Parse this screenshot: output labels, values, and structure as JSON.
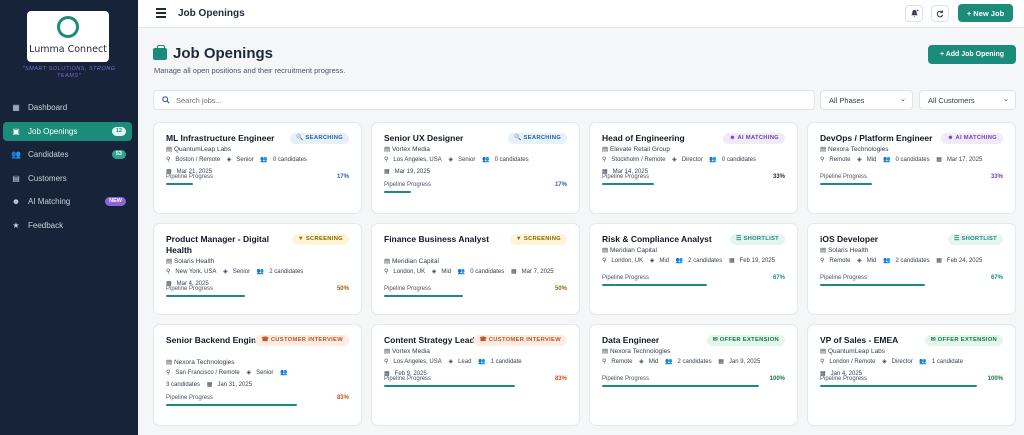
{
  "app": {
    "name": "Lumma Connect",
    "tagline": "\"SMART SOLUTIONS, STRONG TEAMS\""
  },
  "nav": [
    {
      "label": "Dashboard",
      "icon": "dashboard-icon",
      "badge": ""
    },
    {
      "label": "Job Openings",
      "icon": "briefcase-icon",
      "badge": "12",
      "active": true
    },
    {
      "label": "Candidates",
      "icon": "users-icon",
      "badge": "53"
    },
    {
      "label": "Customers",
      "icon": "building-icon",
      "badge": ""
    },
    {
      "label": "AI Matching",
      "icon": "robot-icon",
      "badge": "NEW"
    },
    {
      "label": "Feedback",
      "icon": "star-icon",
      "badge": ""
    }
  ],
  "topbar": {
    "title": "Job Openings",
    "new_job": "+ New Job"
  },
  "header": {
    "title": "Job Openings",
    "subtitle": "Manage all open positions and their recruitment progress.",
    "add_button": "+ Add Job Opening"
  },
  "filters": {
    "search_placeholder": "Search jobs...",
    "phase": "All Phases",
    "customer": "All Customers"
  },
  "pipeline_label": "Pipeline Progress",
  "colors": {
    "accent": "#1b8c7a",
    "sidebar": "#172338"
  },
  "jobs": [
    {
      "title": "ML Infrastructure Engineer",
      "company": "QuantumLeap Labs",
      "status": "SEARCHING",
      "status_type": "searching",
      "location": "Boston / Remote",
      "level": "Senior",
      "candidates": "0 candidates",
      "date": "Mar 21, 2025",
      "progress": 17,
      "progress_color": "#2563a8"
    },
    {
      "title": "Senior UX Designer",
      "company": "Vortex Media",
      "status": "SEARCHING",
      "status_type": "searching",
      "location": "Los Angeles, USA",
      "level": "Senior",
      "candidates": "0 candidates",
      "date": "Mar 19, 2025",
      "progress": 17,
      "progress_color": "#2563a8"
    },
    {
      "title": "Head of Engineering",
      "company": "Elevate Retail Group",
      "status": "AI MATCHING",
      "status_type": "ai",
      "location": "Stockholm / Remote",
      "level": "Director",
      "candidates": "0 candidates",
      "date": "Mar 14, 2025",
      "progress": 33,
      "progress_color": "#1f2a37"
    },
    {
      "title": "DevOps / Platform Engineer",
      "company": "Nexora Technologies",
      "status": "AI MATCHING",
      "status_type": "ai",
      "location": "Remote",
      "level": "Mid",
      "candidates": "0 candidates",
      "date": "Mar 17, 2025",
      "progress": 33,
      "progress_color": "#7042b8"
    },
    {
      "title": "Product Manager - Digital Health",
      "company": "Solaris Health",
      "status": "SCREENING",
      "status_type": "screening",
      "location": "New York, USA",
      "level": "Senior",
      "candidates": "2 candidates",
      "date": "Mar 4, 2025",
      "progress": 50,
      "progress_color": "#a16207"
    },
    {
      "title": "Finance Business Analyst",
      "company": "Meridian Capital",
      "status": "SCREENING",
      "status_type": "screening",
      "location": "London, UK",
      "level": "Mid",
      "candidates": "0 candidates",
      "date": "Mar 7, 2025",
      "progress": 50,
      "progress_color": "#a16207"
    },
    {
      "title": "Risk & Compliance Analyst",
      "company": "Meridian Capital",
      "status": "SHORTLIST",
      "status_type": "shortlist",
      "location": "London, UK",
      "level": "Mid",
      "candidates": "2 candidates",
      "date": "Feb 19, 2025",
      "progress": 67,
      "progress_color": "#1b8c7a"
    },
    {
      "title": "iOS Developer",
      "company": "Solaris Health",
      "status": "SHORTLIST",
      "status_type": "shortlist",
      "location": "Remote",
      "level": "Mid",
      "candidates": "2 candidates",
      "date": "Feb 24, 2025",
      "progress": 67,
      "progress_color": "#1b8c7a"
    },
    {
      "title": "Senior Backend Engineer",
      "company": "Nexora Technologies",
      "status": "CUSTOMER INTERVIEW",
      "status_type": "interview",
      "location": "San Francisco / Remote",
      "level": "Senior",
      "candidates": "3 candidates",
      "date": "Jan 31, 2025",
      "progress": 83,
      "progress_color": "#c2551d"
    },
    {
      "title": "Content Strategy Lead",
      "company": "Vortex Media",
      "status": "CUSTOMER INTERVIEW",
      "status_type": "interview",
      "location": "Los Angeles, USA",
      "level": "Lead",
      "candidates": "1 candidate",
      "date": "Feb 9, 2025",
      "progress": 83,
      "progress_color": "#c2551d"
    },
    {
      "title": "Data Engineer",
      "company": "Nexora Technologies",
      "status": "OFFER EXTENSION",
      "status_type": "offer",
      "location": "Remote",
      "level": "Mid",
      "candidates": "2 candidates",
      "date": "Jan 9, 2025",
      "progress": 100,
      "progress_color": "#157a47"
    },
    {
      "title": "VP of Sales - EMEA",
      "company": "QuantumLeap Labs",
      "status": "OFFER EXTENSION",
      "status_type": "offer",
      "location": "London / Remote",
      "level": "Director",
      "candidates": "1 candidate",
      "date": "Jan 4, 2025",
      "progress": 100,
      "progress_color": "#157a47"
    }
  ]
}
